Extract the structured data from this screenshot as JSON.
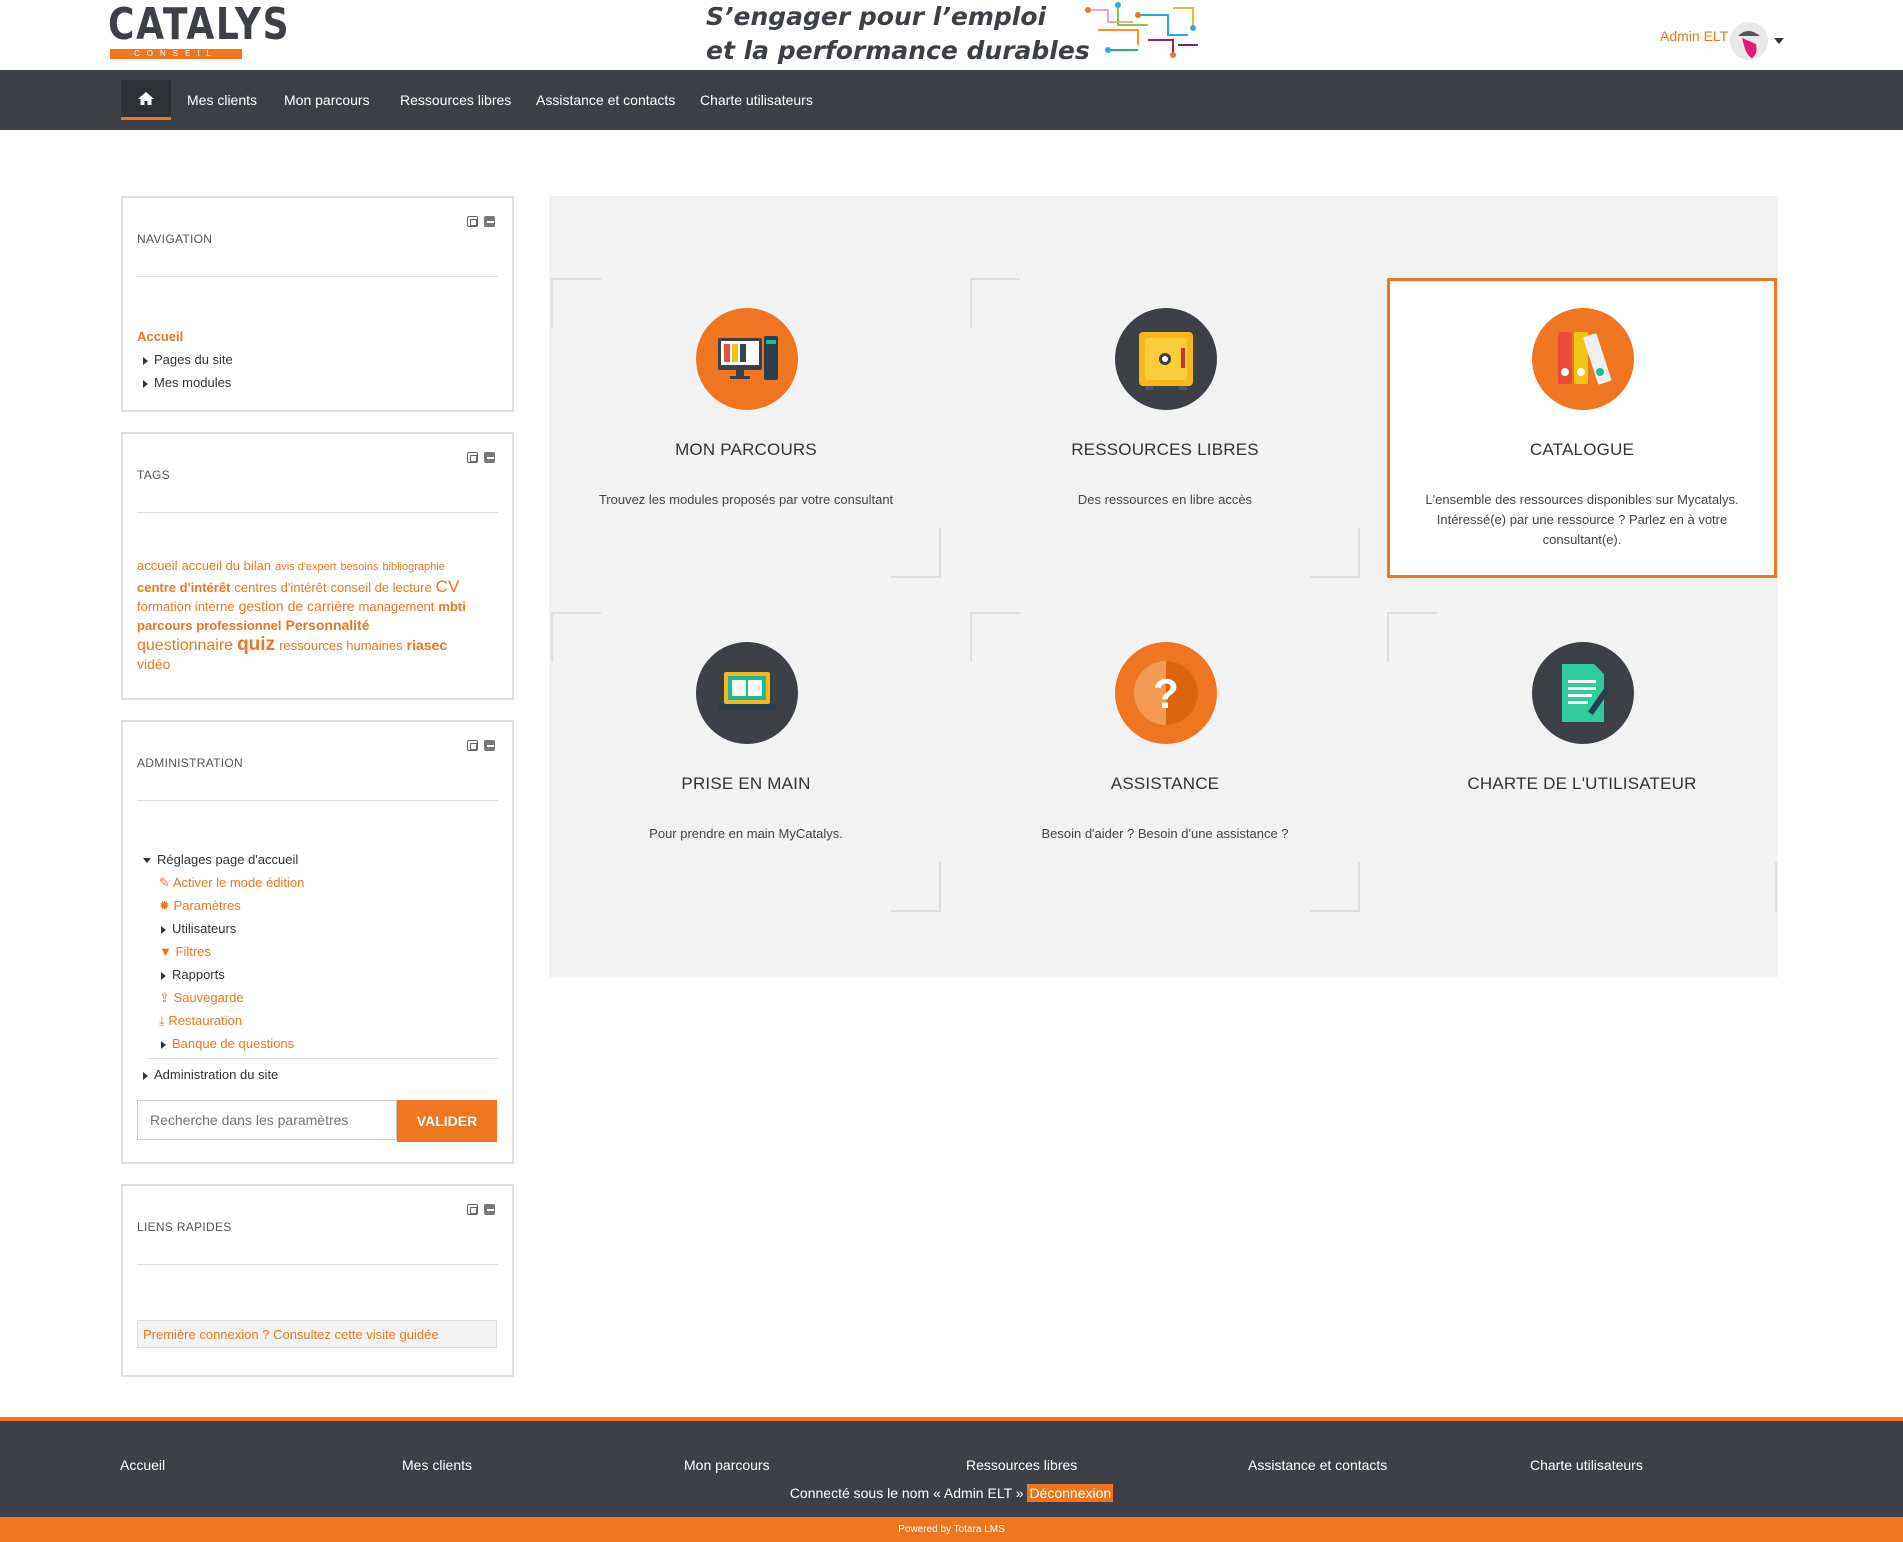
{
  "header": {
    "logo_text": "CATALYS",
    "logo_sub": "CONSEIL",
    "slogan_line1": "S’engager pour l’emploi",
    "slogan_line2": "et la performance durables",
    "user_name": "Admin ELT"
  },
  "nav": {
    "items": [
      "Mes clients",
      "Mon parcours",
      "Ressources libres",
      "Assistance et contacts",
      "Charte utilisateurs"
    ]
  },
  "navigation_block": {
    "title": "NAVIGATION",
    "home": "Accueil",
    "items": [
      "Pages du site",
      "Mes modules"
    ]
  },
  "tags_block": {
    "title": "TAGS",
    "tags": [
      "accueil",
      "accueil du bilan",
      "avis d'expert",
      "besoins",
      "bibliographie",
      "centre d'intérêt",
      "centres d'intérêt",
      "conseil de lecture",
      "CV",
      "formation interne",
      "gestion de carrière",
      "management",
      "mbti",
      "parcours professionnel",
      "Personnalité",
      "questionnaire",
      "quiz",
      "ressources humaines",
      "riasec",
      "vidéo"
    ]
  },
  "admin_block": {
    "title": "ADMINISTRATION",
    "section": "Réglages page d'accueil",
    "items": [
      "Activer le mode édition",
      "Paramètres",
      "Utilisateurs",
      "Filtres",
      "Rapports",
      "Sauvegarde",
      "Restauration",
      "Banque de questions"
    ],
    "site_admin": "Administration du site",
    "search_placeholder": "Recherche dans les paramètres",
    "submit": "VALIDER"
  },
  "quick_links_block": {
    "title": "LIENS RAPIDES",
    "link": "Première connexion ? Consultez cette visite guidée"
  },
  "tiles": [
    {
      "title": "MON PARCOURS",
      "desc": "Trouvez les modules proposés par votre consultant",
      "icon": "monitor-binders-icon"
    },
    {
      "title": "RESSOURCES LIBRES",
      "desc": "Des ressources en libre accès",
      "icon": "safe-icon"
    },
    {
      "title": "CATALOGUE",
      "desc": "L'ensemble des ressources disponibles sur Mycatalys. Intéressé(e) par une ressource ? Parlez en à votre consultant(e).",
      "icon": "binders-icon"
    },
    {
      "title": "PRISE EN MAIN",
      "desc": "Pour prendre en main MyCatalys.",
      "icon": "laptop-book-icon"
    },
    {
      "title": "ASSISTANCE",
      "desc": "Besoin d'aider ? Besoin d'une assistance ?",
      "icon": "question-icon"
    },
    {
      "title": "CHARTE DE L'UTILISATEUR",
      "desc": "",
      "icon": "document-pen-icon"
    }
  ],
  "footer": {
    "links": [
      "Accueil",
      "Mes clients",
      "Mon parcours",
      "Ressources libres",
      "Assistance et contacts",
      "Charte utilisateurs"
    ],
    "connected_text": "Connecté sous le nom « Admin ELT »",
    "logout": "Déconnexion",
    "powered": "Powered by Totara LMS"
  },
  "colors": {
    "accent": "#ee7622",
    "dark": "#3d4046",
    "panel": "#f2f2f2"
  }
}
